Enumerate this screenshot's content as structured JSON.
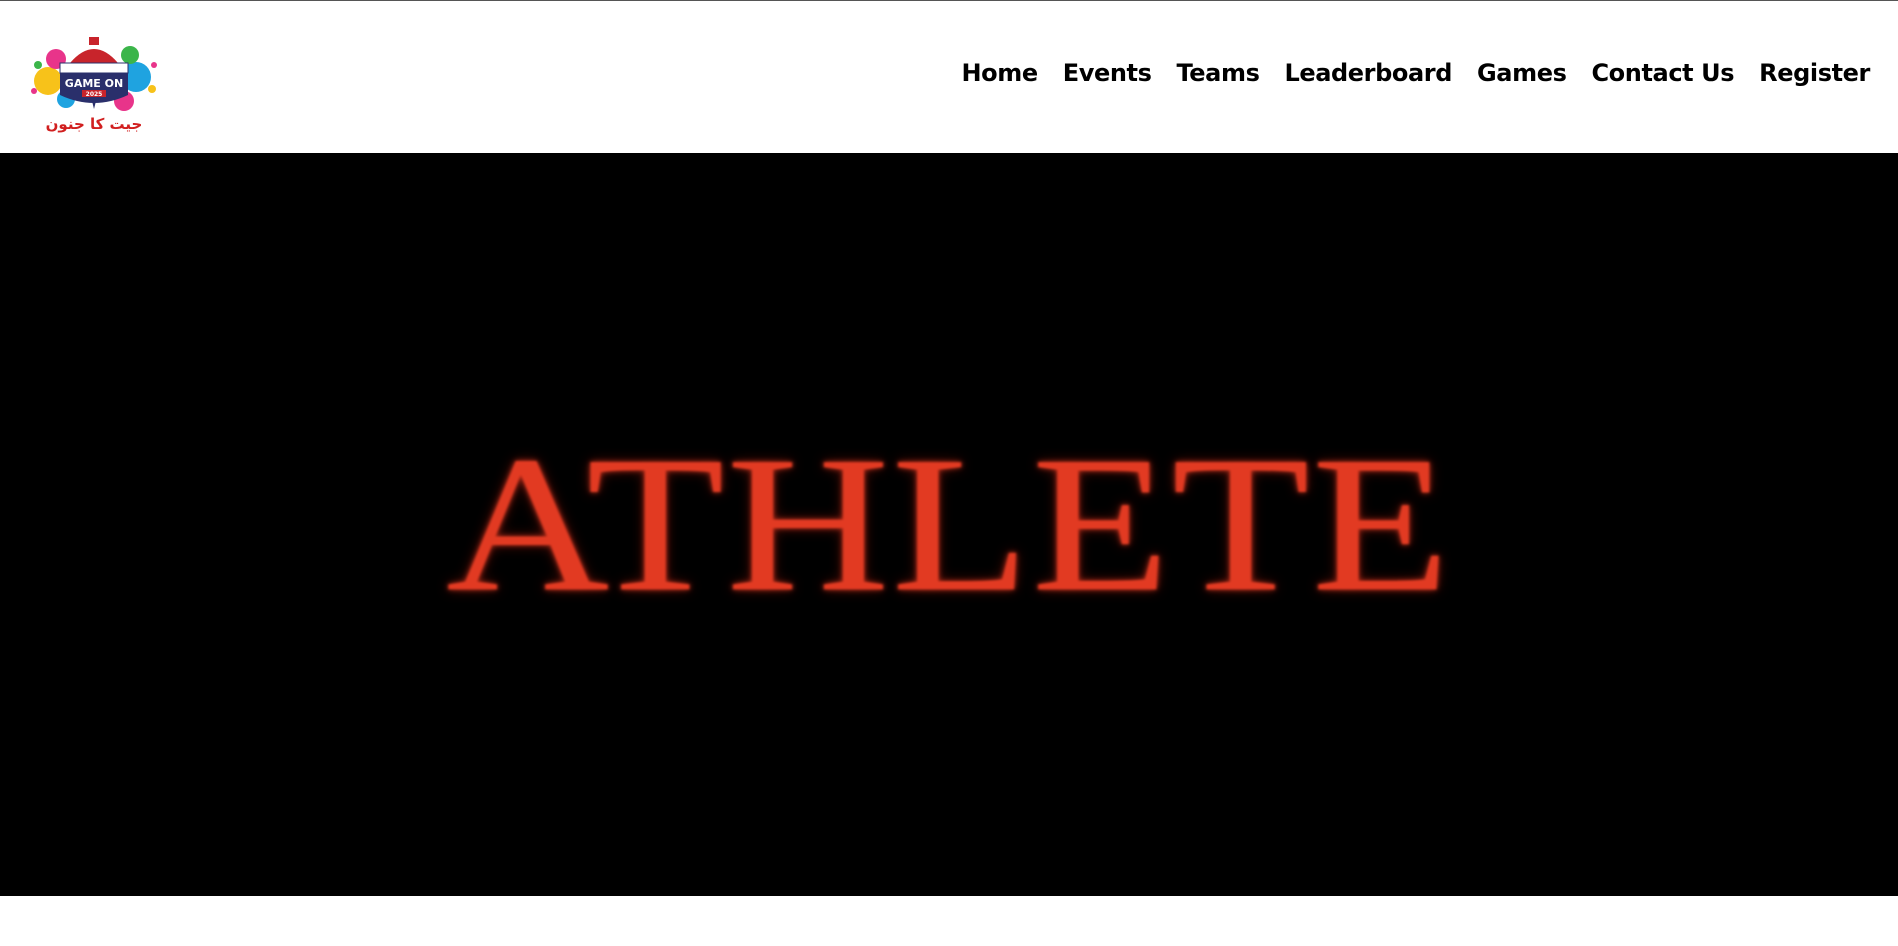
{
  "header": {
    "logo": {
      "badge_text": "GAME ON",
      "year_text": "2025",
      "urdu_text": "جیت کا جنون",
      "colors": {
        "badge": "#2a2f6b",
        "dome": "#c8242b",
        "splash_yellow": "#f7c21a",
        "splash_blue": "#1fa3e0",
        "splash_pink": "#e8348a",
        "splash_green": "#3bb54a",
        "urdu_red": "#d11f1f"
      }
    },
    "nav": [
      {
        "label": "Home"
      },
      {
        "label": "Events"
      },
      {
        "label": "Teams"
      },
      {
        "label": "Leaderboard"
      },
      {
        "label": "Games"
      },
      {
        "label": "Contact Us"
      },
      {
        "label": "Register"
      }
    ]
  },
  "hero": {
    "title": "ATHLETE",
    "title_color": "#e23a22",
    "background": "#000000"
  }
}
